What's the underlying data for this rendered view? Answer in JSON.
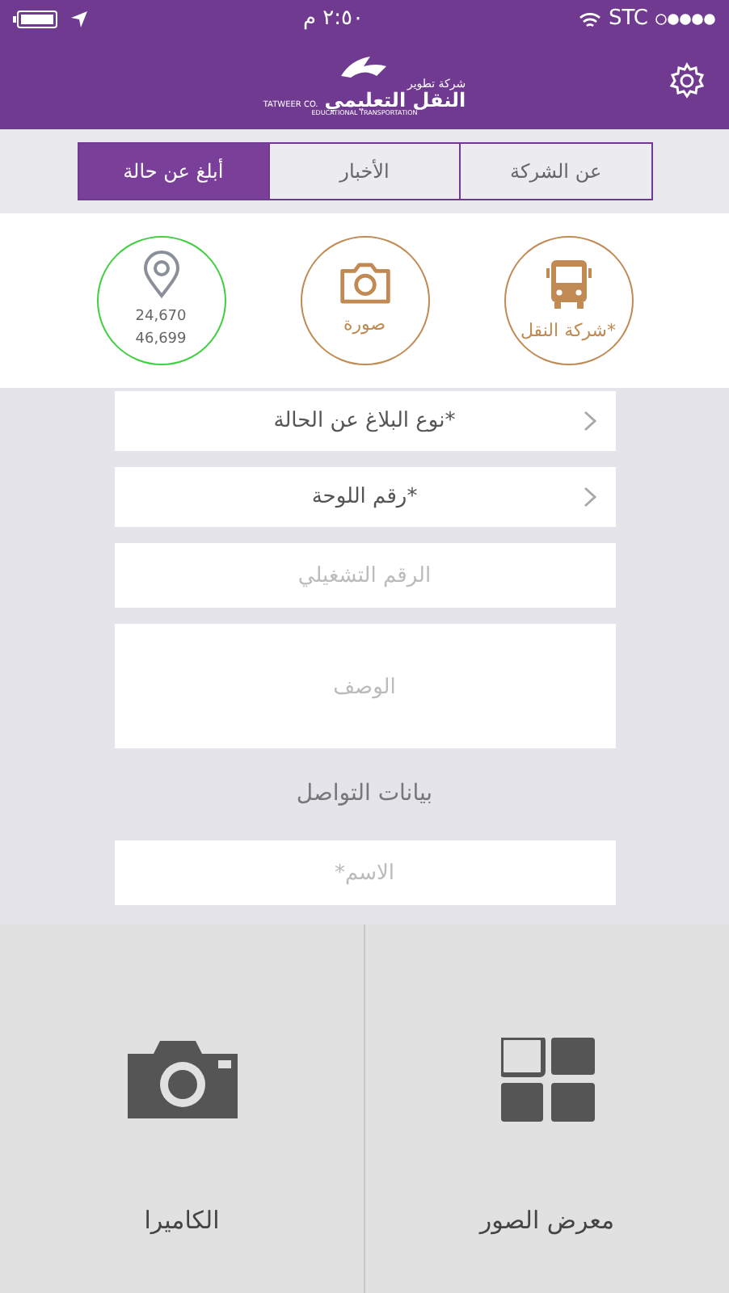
{
  "status_bar": {
    "time": "٢:٥٠ م",
    "carrier": "STC"
  },
  "header": {
    "logo": {
      "line_1": "شركة تطوير",
      "line_2": "TATWEER CO.",
      "line_3": "النقل التعليمي",
      "line_4": "EDUCATIONAL TRANSPORTATION"
    }
  },
  "tabs": [
    {
      "label": "عن الشركة",
      "selected": false
    },
    {
      "label": "الأخبار",
      "selected": false
    },
    {
      "label": "أبلغ عن حالة",
      "selected": true
    }
  ],
  "attachments": [
    {
      "kind": "bus",
      "label": "شركة النقل*",
      "color": "#c08a52"
    },
    {
      "kind": "camera",
      "label": "صورة",
      "color": "#c08a52"
    },
    {
      "kind": "location",
      "lines": [
        "24,670",
        "46,699"
      ],
      "color": "#3fcf3f"
    }
  ],
  "form": [
    {
      "kind": "select",
      "label": "نوع البلاغ عن الحالة*"
    },
    {
      "kind": "select",
      "label": "رقم اللوحة*"
    },
    {
      "kind": "input",
      "placeholder": "الرقم التشغيلي"
    },
    {
      "kind": "textarea",
      "placeholder": "الوصف"
    },
    {
      "kind": "heading",
      "label": "بيانات التواصل"
    },
    {
      "kind": "input",
      "placeholder": "الاسم*"
    }
  ],
  "sources": [
    {
      "kind": "gallery",
      "label": "معرض الصور"
    },
    {
      "kind": "camera",
      "label": "الكاميرا"
    }
  ]
}
